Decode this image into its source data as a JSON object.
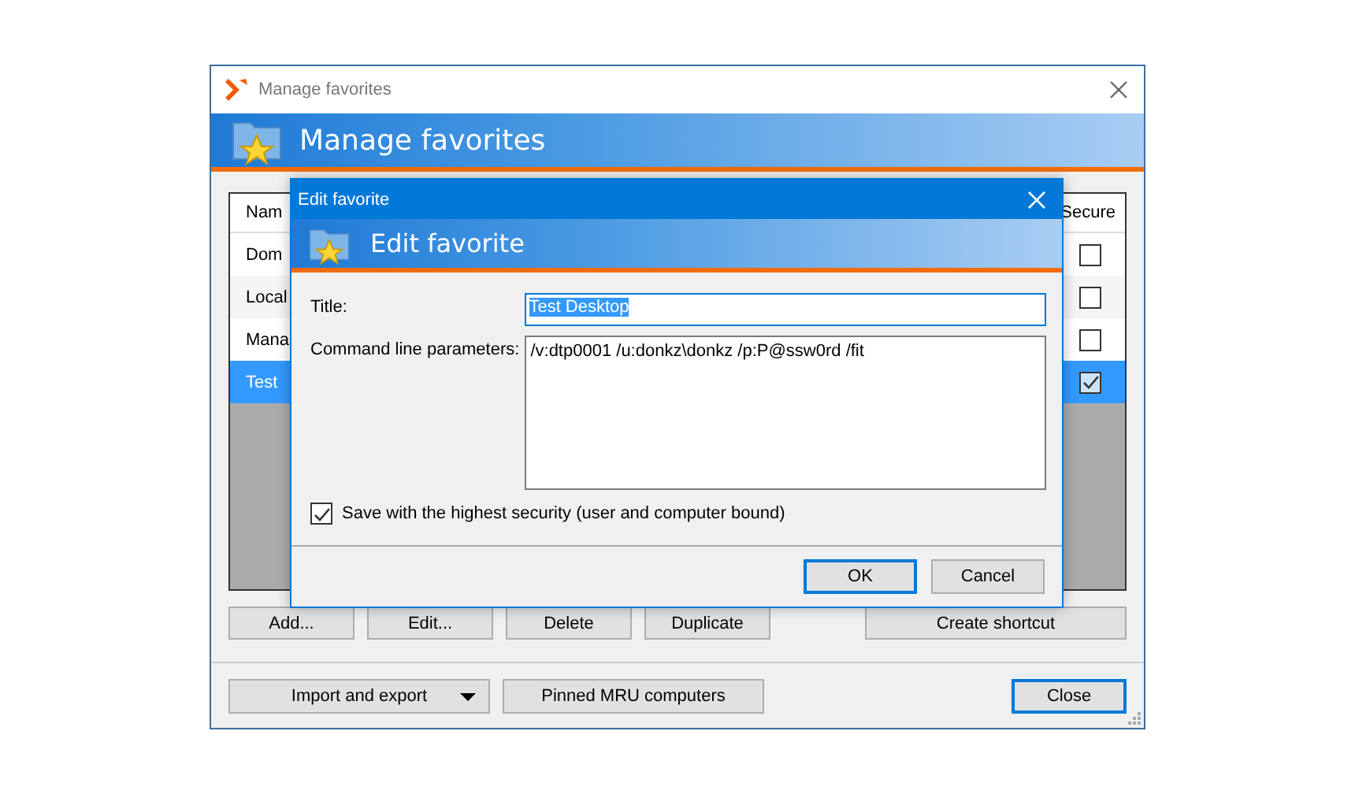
{
  "window": {
    "title": "Manage favorites",
    "banner": "Manage favorites"
  },
  "table": {
    "columns": [
      "Nam",
      "Secure"
    ],
    "rows": [
      {
        "name": "Dom",
        "secure": false,
        "selected": false
      },
      {
        "name": "Local",
        "secure": false,
        "selected": false
      },
      {
        "name": "Mana",
        "secure": false,
        "selected": false
      },
      {
        "name": "Test",
        "secure": true,
        "selected": true
      }
    ]
  },
  "list_buttons": [
    "Add...",
    "Edit...",
    "Delete",
    "Duplicate",
    "Create shortcut"
  ],
  "footer_buttons": [
    {
      "label": "Import and export",
      "kind": "dropdown"
    },
    {
      "label": "Pinned MRU computers",
      "kind": "plain"
    },
    {
      "label": "Close",
      "kind": "default"
    }
  ],
  "dialog": {
    "title": "Edit favorite",
    "banner": "Edit favorite",
    "fields": [
      {
        "label": "Title:",
        "value": "Test Desktop",
        "kind": "line",
        "selected": true
      },
      {
        "label": "Command line parameters:",
        "value": "/v:dtp0001 /u:donkz\\donkz /p:P@ssw0rd /fit",
        "kind": "multiline",
        "selected": false
      }
    ],
    "checkbox": {
      "label": "Save with the highest security (user and computer bound)",
      "checked": true
    },
    "buttons": [
      {
        "label": "OK",
        "default": true
      },
      {
        "label": "Cancel",
        "default": false
      }
    ]
  }
}
